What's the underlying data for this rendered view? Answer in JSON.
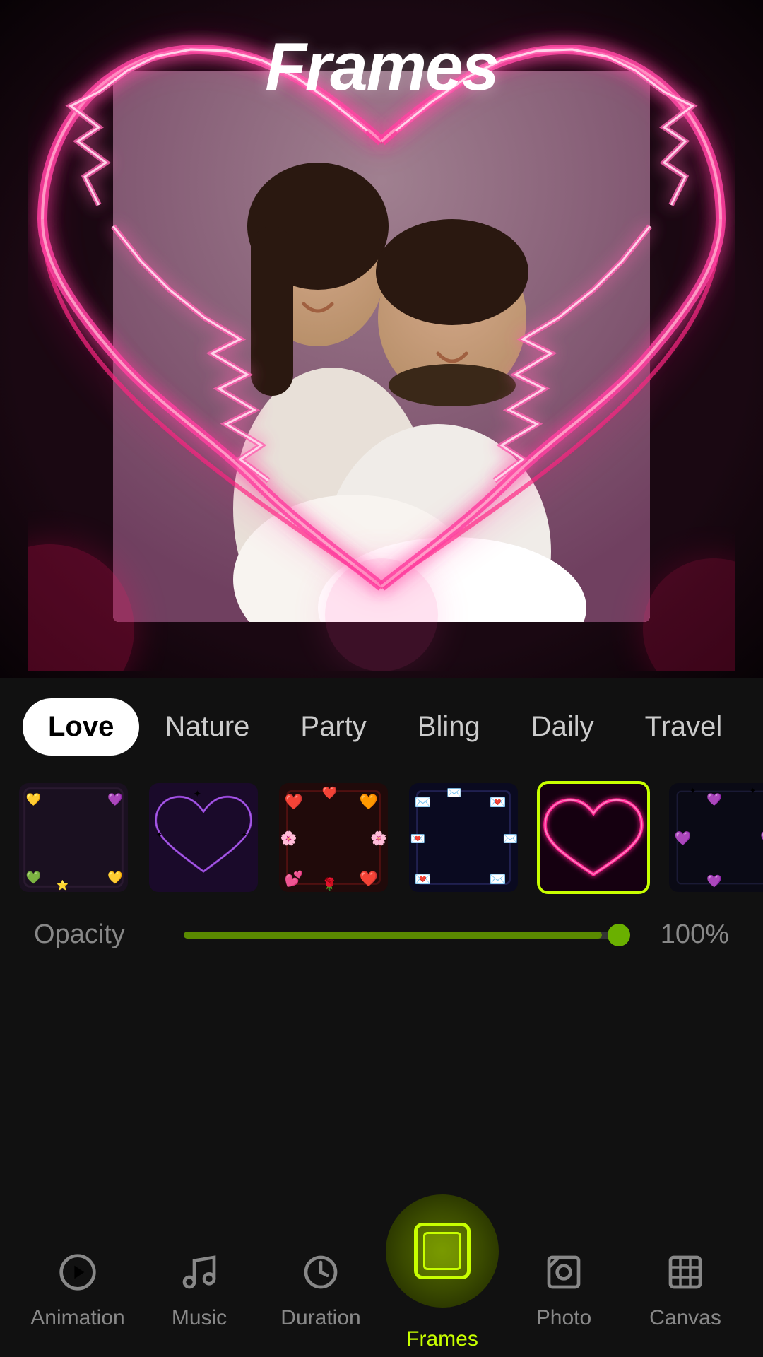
{
  "title": "Frames",
  "preview": {
    "hasCouple": true
  },
  "categories": [
    {
      "id": "love",
      "label": "Love",
      "active": true
    },
    {
      "id": "nature",
      "label": "Nature",
      "active": false
    },
    {
      "id": "party",
      "label": "Party",
      "active": false
    },
    {
      "id": "bling",
      "label": "Bling",
      "active": false
    },
    {
      "id": "daily",
      "label": "Daily",
      "active": false
    },
    {
      "id": "travel",
      "label": "Travel",
      "active": false
    }
  ],
  "frames": [
    {
      "id": "f1",
      "name": "Hearts Dark",
      "selected": false
    },
    {
      "id": "f2",
      "name": "Purple Heart",
      "selected": false
    },
    {
      "id": "f3",
      "name": "Red Hearts Border",
      "selected": false
    },
    {
      "id": "f4",
      "name": "Love Letters",
      "selected": false
    },
    {
      "id": "f5",
      "name": "Pink Neon Heart",
      "selected": true
    },
    {
      "id": "f6",
      "name": "Hearts Sparkle",
      "selected": false
    }
  ],
  "opacity": {
    "label": "Opacity",
    "value": 100,
    "display": "100%",
    "percent": 94
  },
  "nav": [
    {
      "id": "animation",
      "label": "Animation",
      "icon": "play-circle",
      "active": false
    },
    {
      "id": "music",
      "label": "Music",
      "icon": "music-note",
      "active": false
    },
    {
      "id": "duration",
      "label": "Duration",
      "icon": "timer",
      "active": false
    },
    {
      "id": "frames",
      "label": "Frames",
      "icon": "frame",
      "active": true
    },
    {
      "id": "photo",
      "label": "Photo",
      "icon": "photo",
      "active": false
    },
    {
      "id": "canvas",
      "label": "Canvas",
      "icon": "canvas",
      "active": false
    }
  ]
}
